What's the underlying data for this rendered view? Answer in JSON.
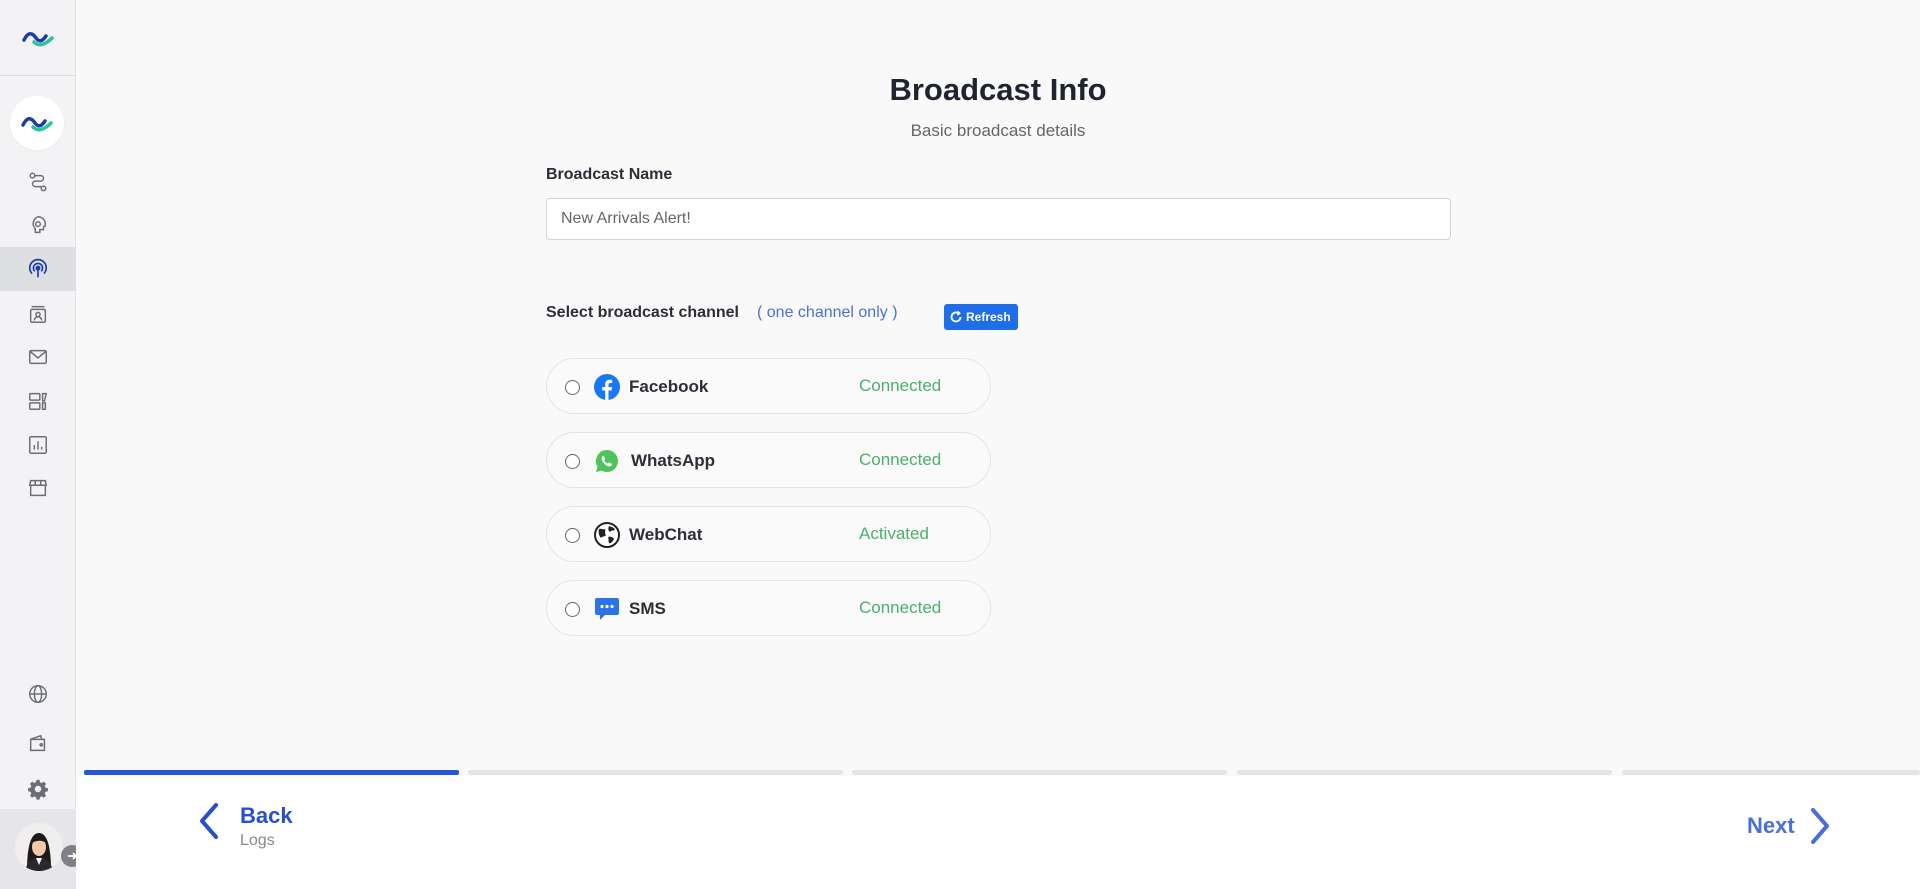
{
  "page": {
    "title": "Broadcast Info",
    "subtitle": "Basic broadcast details"
  },
  "form": {
    "name_label": "Broadcast Name",
    "name_value": "New Arrivals Alert!",
    "channel_heading": "Select broadcast channel",
    "channel_note": "( one channel only )",
    "refresh_label": "Refresh"
  },
  "channels": [
    {
      "name": "Facebook",
      "status": "Connected",
      "icon": "facebook-icon"
    },
    {
      "name": "WhatsApp",
      "status": "Connected",
      "icon": "whatsapp-icon"
    },
    {
      "name": "WebChat",
      "status": "Activated",
      "icon": "globe-icon"
    },
    {
      "name": "SMS",
      "status": "Connected",
      "icon": "sms-icon"
    }
  ],
  "progress": {
    "current_step": 1,
    "total_steps": 5
  },
  "nav": {
    "back_label": "Back",
    "back_sub": "Logs",
    "next_label": "Next"
  },
  "sidebar": {
    "items": [
      "flows-icon",
      "bot-icon",
      "broadcast-icon",
      "contacts-icon",
      "inbox-icon",
      "templates-icon",
      "reports-icon",
      "store-icon",
      "globe-icon",
      "wallet-icon",
      "gear-icon"
    ],
    "active": "broadcast-icon"
  },
  "colors": {
    "accent": "#2456d6",
    "status_green": "#4caf6a",
    "refresh_blue": "#1f6ee8"
  }
}
